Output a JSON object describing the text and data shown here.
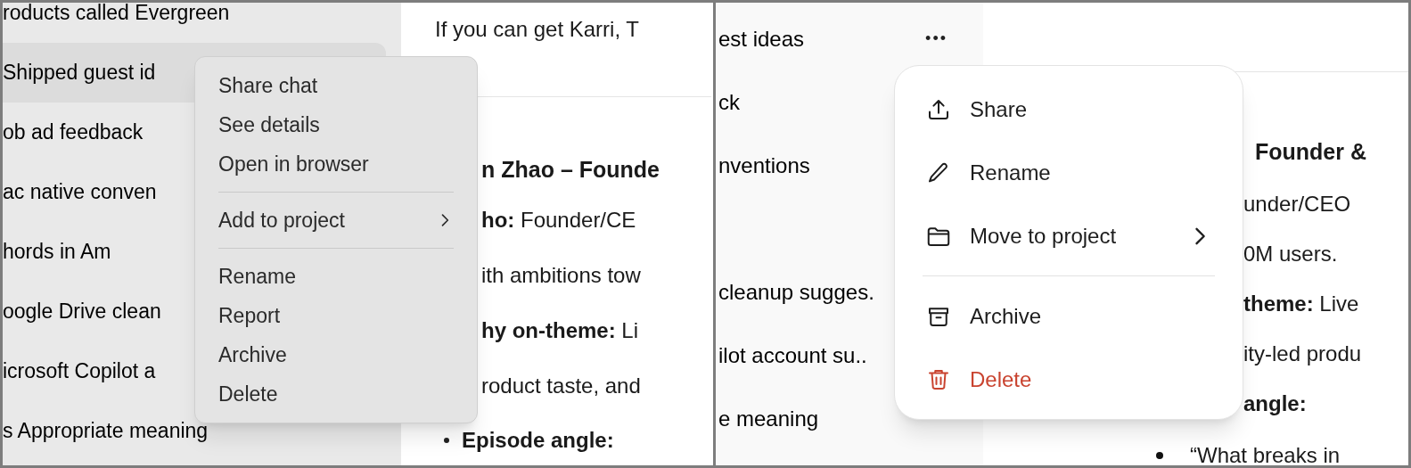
{
  "panels": [
    {
      "kind": "native",
      "sidebar": {
        "items": [
          {
            "title": "roducts called Evergreen",
            "selected": false
          },
          {
            "title": "Shipped guest id",
            "selected": true
          },
          {
            "title": "ob ad feedback",
            "selected": false
          },
          {
            "title": "ac native conven",
            "selected": false
          },
          {
            "title": "hords in Am",
            "selected": false
          },
          {
            "title": "oogle Drive clean",
            "selected": false
          },
          {
            "title": "icrosoft Copilot a",
            "selected": false
          },
          {
            "title": "s Appropriate meaning",
            "selected": false
          }
        ]
      },
      "content": {
        "lines": [
          {
            "kind": "text",
            "text": "If you can get Karri, T"
          },
          {
            "kind": "rule"
          },
          {
            "kind": "heading",
            "text": "n Zhao – Founde"
          },
          {
            "kind": "text",
            "text": "**ho:** Founder/CE"
          },
          {
            "kind": "text",
            "text": "ith ambitions tow"
          },
          {
            "kind": "text",
            "text": "**hy on-theme:** Li"
          },
          {
            "kind": "text",
            "text": "roduct taste, and"
          },
          {
            "kind": "bullet",
            "text": "Episode angle:",
            "bold": true
          }
        ]
      },
      "menu": {
        "items": [
          {
            "kind": "item",
            "label": "Share chat"
          },
          {
            "kind": "item",
            "label": "See details"
          },
          {
            "kind": "item",
            "label": "Open in browser"
          },
          {
            "kind": "divider"
          },
          {
            "kind": "submenu",
            "label": "Add to project"
          },
          {
            "kind": "divider"
          },
          {
            "kind": "item",
            "label": "Rename"
          },
          {
            "kind": "item",
            "label": "Report"
          },
          {
            "kind": "item",
            "label": "Archive"
          },
          {
            "kind": "item",
            "label": "Delete"
          }
        ]
      }
    },
    {
      "kind": "web",
      "sidebar": {
        "items": [
          {
            "title": "est ideas",
            "selected": false,
            "menu_glyph": "•••"
          },
          {
            "title": "ck",
            "selected": false
          },
          {
            "title": "nventions",
            "selected": false
          },
          {
            "title": "cleanup sugges.",
            "selected": false
          },
          {
            "title": "ilot account su..",
            "selected": false
          },
          {
            "title": "e meaning",
            "selected": false
          }
        ]
      },
      "content": {
        "lines": [
          {
            "kind": "rule"
          },
          {
            "kind": "heading",
            "text": "Founder &"
          },
          {
            "kind": "text",
            "text": "under/CEO"
          },
          {
            "kind": "text",
            "text": "0M users."
          },
          {
            "kind": "text",
            "text": "**theme:** Live"
          },
          {
            "kind": "text",
            "text": "ity-led produ"
          },
          {
            "kind": "text",
            "text": "angle:",
            "bold": true
          },
          {
            "kind": "bullet",
            "text": "“What breaks in",
            "bold": false
          }
        ]
      },
      "menu": {
        "items": [
          {
            "kind": "share",
            "label": "Share"
          },
          {
            "kind": "rename",
            "label": "Rename"
          },
          {
            "kind": "move",
            "label": "Move to project"
          },
          {
            "kind": "divider"
          },
          {
            "kind": "archive",
            "label": "Archive"
          },
          {
            "kind": "delete",
            "label": "Delete"
          }
        ]
      }
    }
  ]
}
